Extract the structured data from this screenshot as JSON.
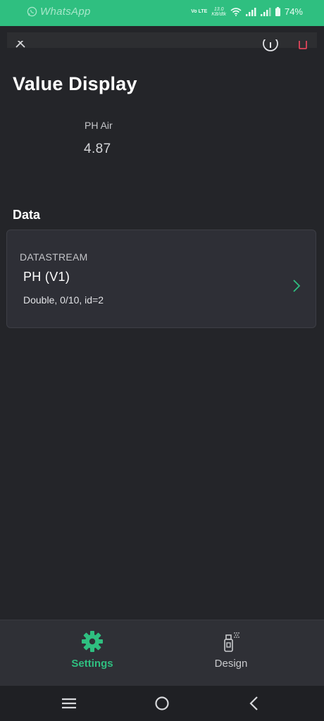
{
  "status_bar": {
    "app_name": "WhatsApp",
    "network_label": "Vo LTE",
    "speed_value": "13.0",
    "speed_unit": "KB/dtk",
    "battery": "74%"
  },
  "page": {
    "title": "Value Display"
  },
  "widget": {
    "label": "PH Air",
    "value": "4.87"
  },
  "data_section": {
    "title": "Data",
    "datastream": {
      "heading": "DATASTREAM",
      "name": "PH (V1)",
      "meta": "Double, 0/10, id=2"
    }
  },
  "tabs": [
    {
      "label": "Settings",
      "icon": "gear-icon",
      "active": true
    },
    {
      "label": "Design",
      "icon": "spray-icon",
      "active": false
    }
  ],
  "colors": {
    "accent": "#2fbf80",
    "background": "#242529",
    "card": "#2e2f36",
    "delete": "#e0455a"
  }
}
